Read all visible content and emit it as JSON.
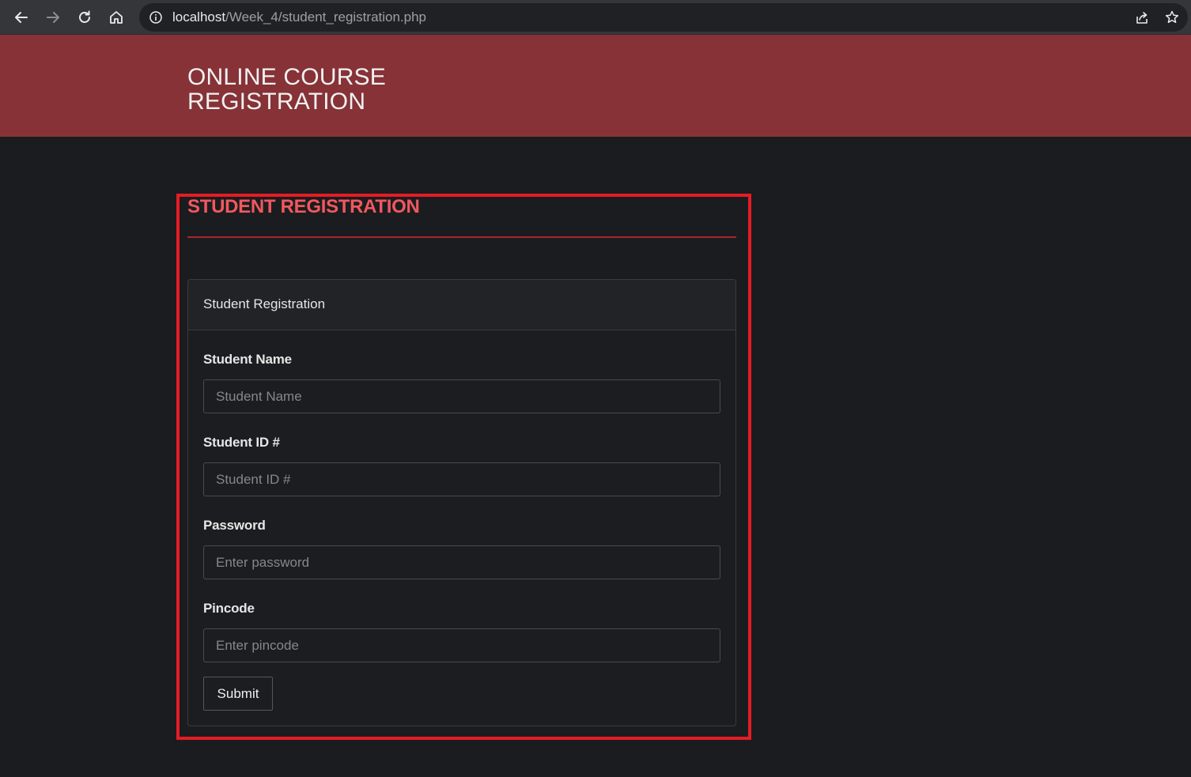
{
  "browser": {
    "url_host": "localhost",
    "url_path": "/Week_4/student_registration.php"
  },
  "header": {
    "title_line1": "ONLINE COURSE",
    "title_line2": "REGISTRATION"
  },
  "section": {
    "title": "STUDENT REGISTRATION"
  },
  "card": {
    "header": "Student Registration",
    "fields": [
      {
        "label": "Student Name",
        "placeholder": "Student Name",
        "value": ""
      },
      {
        "label": "Student ID #",
        "placeholder": "Student ID #",
        "value": ""
      },
      {
        "label": "Password",
        "placeholder": "Enter password",
        "value": ""
      },
      {
        "label": "Pincode",
        "placeholder": "Enter pincode",
        "value": ""
      }
    ],
    "submit_label": "Submit"
  },
  "colors": {
    "header_bg": "#863237",
    "page_bg": "#1b1c1f",
    "section_title": "#f0585e",
    "highlight_frame": "#e51c24"
  },
  "icons": [
    "back-arrow-icon",
    "forward-arrow-icon",
    "reload-icon",
    "home-icon",
    "info-icon",
    "share-icon",
    "star-icon"
  ]
}
